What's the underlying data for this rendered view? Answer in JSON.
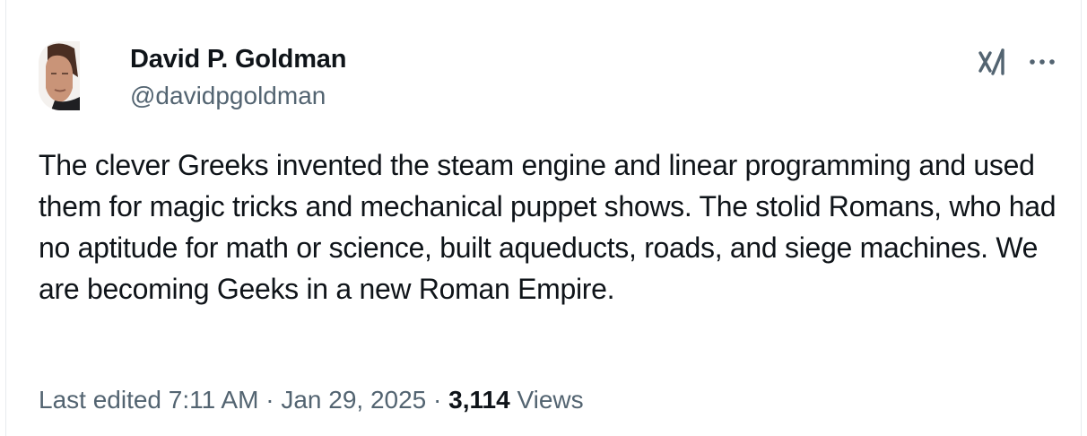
{
  "author": {
    "display_name": "David P. Goldman",
    "handle": "@davidpgoldman",
    "avatar_icon": "profile-photo"
  },
  "header_actions": {
    "grok_icon": "grok-icon",
    "more_icon": "more-options-icon"
  },
  "tweet": {
    "text": "The clever Greeks invented the steam engine and linear programming and used them for magic tricks and mechanical puppet shows. The stolid Romans, who had no aptitude for math or science, built aqueducts, roads, and siege machines. We are becoming Geeks in a new Roman Empire."
  },
  "meta": {
    "edited_prefix": "Last edited",
    "time": "7:11 AM",
    "separator": " · ",
    "date": "Jan 29, 2025",
    "views_count": "3,114",
    "views_label": "Views"
  },
  "colors": {
    "text_primary": "#0f1419",
    "text_secondary": "#536471",
    "border": "#e7ebee"
  }
}
